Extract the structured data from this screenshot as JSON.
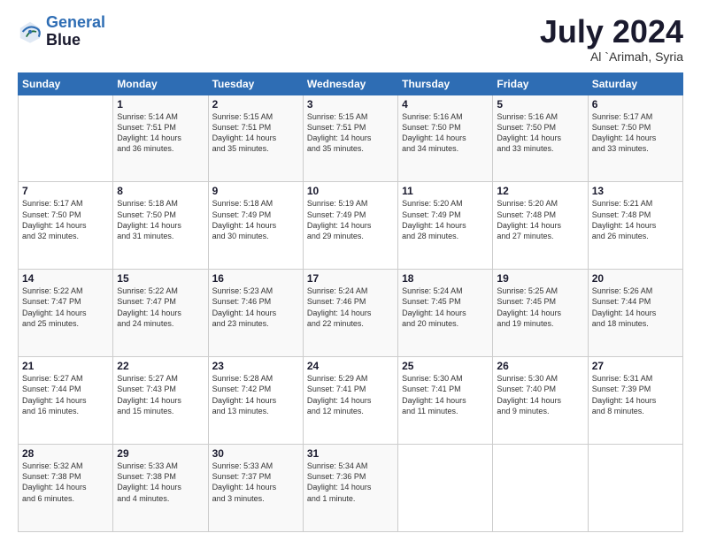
{
  "header": {
    "logo_line1": "General",
    "logo_line2": "Blue",
    "month_title": "July 2024",
    "location": "Al `Arimah, Syria"
  },
  "columns": [
    "Sunday",
    "Monday",
    "Tuesday",
    "Wednesday",
    "Thursday",
    "Friday",
    "Saturday"
  ],
  "weeks": [
    [
      {
        "day": "",
        "content": ""
      },
      {
        "day": "1",
        "content": "Sunrise: 5:14 AM\nSunset: 7:51 PM\nDaylight: 14 hours\nand 36 minutes."
      },
      {
        "day": "2",
        "content": "Sunrise: 5:15 AM\nSunset: 7:51 PM\nDaylight: 14 hours\nand 35 minutes."
      },
      {
        "day": "3",
        "content": "Sunrise: 5:15 AM\nSunset: 7:51 PM\nDaylight: 14 hours\nand 35 minutes."
      },
      {
        "day": "4",
        "content": "Sunrise: 5:16 AM\nSunset: 7:50 PM\nDaylight: 14 hours\nand 34 minutes."
      },
      {
        "day": "5",
        "content": "Sunrise: 5:16 AM\nSunset: 7:50 PM\nDaylight: 14 hours\nand 33 minutes."
      },
      {
        "day": "6",
        "content": "Sunrise: 5:17 AM\nSunset: 7:50 PM\nDaylight: 14 hours\nand 33 minutes."
      }
    ],
    [
      {
        "day": "7",
        "content": "Sunrise: 5:17 AM\nSunset: 7:50 PM\nDaylight: 14 hours\nand 32 minutes."
      },
      {
        "day": "8",
        "content": "Sunrise: 5:18 AM\nSunset: 7:50 PM\nDaylight: 14 hours\nand 31 minutes."
      },
      {
        "day": "9",
        "content": "Sunrise: 5:18 AM\nSunset: 7:49 PM\nDaylight: 14 hours\nand 30 minutes."
      },
      {
        "day": "10",
        "content": "Sunrise: 5:19 AM\nSunset: 7:49 PM\nDaylight: 14 hours\nand 29 minutes."
      },
      {
        "day": "11",
        "content": "Sunrise: 5:20 AM\nSunset: 7:49 PM\nDaylight: 14 hours\nand 28 minutes."
      },
      {
        "day": "12",
        "content": "Sunrise: 5:20 AM\nSunset: 7:48 PM\nDaylight: 14 hours\nand 27 minutes."
      },
      {
        "day": "13",
        "content": "Sunrise: 5:21 AM\nSunset: 7:48 PM\nDaylight: 14 hours\nand 26 minutes."
      }
    ],
    [
      {
        "day": "14",
        "content": "Sunrise: 5:22 AM\nSunset: 7:47 PM\nDaylight: 14 hours\nand 25 minutes."
      },
      {
        "day": "15",
        "content": "Sunrise: 5:22 AM\nSunset: 7:47 PM\nDaylight: 14 hours\nand 24 minutes."
      },
      {
        "day": "16",
        "content": "Sunrise: 5:23 AM\nSunset: 7:46 PM\nDaylight: 14 hours\nand 23 minutes."
      },
      {
        "day": "17",
        "content": "Sunrise: 5:24 AM\nSunset: 7:46 PM\nDaylight: 14 hours\nand 22 minutes."
      },
      {
        "day": "18",
        "content": "Sunrise: 5:24 AM\nSunset: 7:45 PM\nDaylight: 14 hours\nand 20 minutes."
      },
      {
        "day": "19",
        "content": "Sunrise: 5:25 AM\nSunset: 7:45 PM\nDaylight: 14 hours\nand 19 minutes."
      },
      {
        "day": "20",
        "content": "Sunrise: 5:26 AM\nSunset: 7:44 PM\nDaylight: 14 hours\nand 18 minutes."
      }
    ],
    [
      {
        "day": "21",
        "content": "Sunrise: 5:27 AM\nSunset: 7:44 PM\nDaylight: 14 hours\nand 16 minutes."
      },
      {
        "day": "22",
        "content": "Sunrise: 5:27 AM\nSunset: 7:43 PM\nDaylight: 14 hours\nand 15 minutes."
      },
      {
        "day": "23",
        "content": "Sunrise: 5:28 AM\nSunset: 7:42 PM\nDaylight: 14 hours\nand 13 minutes."
      },
      {
        "day": "24",
        "content": "Sunrise: 5:29 AM\nSunset: 7:41 PM\nDaylight: 14 hours\nand 12 minutes."
      },
      {
        "day": "25",
        "content": "Sunrise: 5:30 AM\nSunset: 7:41 PM\nDaylight: 14 hours\nand 11 minutes."
      },
      {
        "day": "26",
        "content": "Sunrise: 5:30 AM\nSunset: 7:40 PM\nDaylight: 14 hours\nand 9 minutes."
      },
      {
        "day": "27",
        "content": "Sunrise: 5:31 AM\nSunset: 7:39 PM\nDaylight: 14 hours\nand 8 minutes."
      }
    ],
    [
      {
        "day": "28",
        "content": "Sunrise: 5:32 AM\nSunset: 7:38 PM\nDaylight: 14 hours\nand 6 minutes."
      },
      {
        "day": "29",
        "content": "Sunrise: 5:33 AM\nSunset: 7:38 PM\nDaylight: 14 hours\nand 4 minutes."
      },
      {
        "day": "30",
        "content": "Sunrise: 5:33 AM\nSunset: 7:37 PM\nDaylight: 14 hours\nand 3 minutes."
      },
      {
        "day": "31",
        "content": "Sunrise: 5:34 AM\nSunset: 7:36 PM\nDaylight: 14 hours\nand 1 minute."
      },
      {
        "day": "",
        "content": ""
      },
      {
        "day": "",
        "content": ""
      },
      {
        "day": "",
        "content": ""
      }
    ]
  ]
}
